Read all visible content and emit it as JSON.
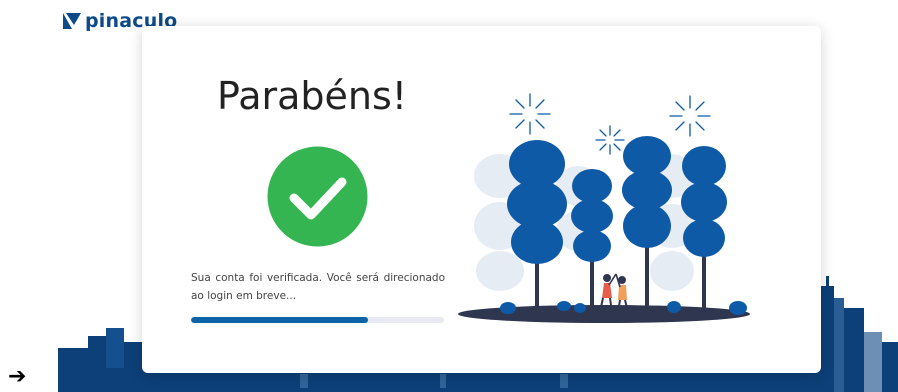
{
  "brand": {
    "name": "pinaculo",
    "color": "#0d4a87"
  },
  "card": {
    "title": "Parabéns!",
    "message": "Sua conta foi verificada. Você será direcionado ao login em breve...",
    "progress": 0.7
  },
  "colors": {
    "success": "#34b551",
    "accent": "#0d63a8",
    "tree": "#0e5aa7",
    "skyline": "#0d3f78"
  },
  "icons": {
    "success": "check-circle-icon",
    "arrow": "right-arrow-icon"
  },
  "footer": {
    "arrow": "➔"
  }
}
